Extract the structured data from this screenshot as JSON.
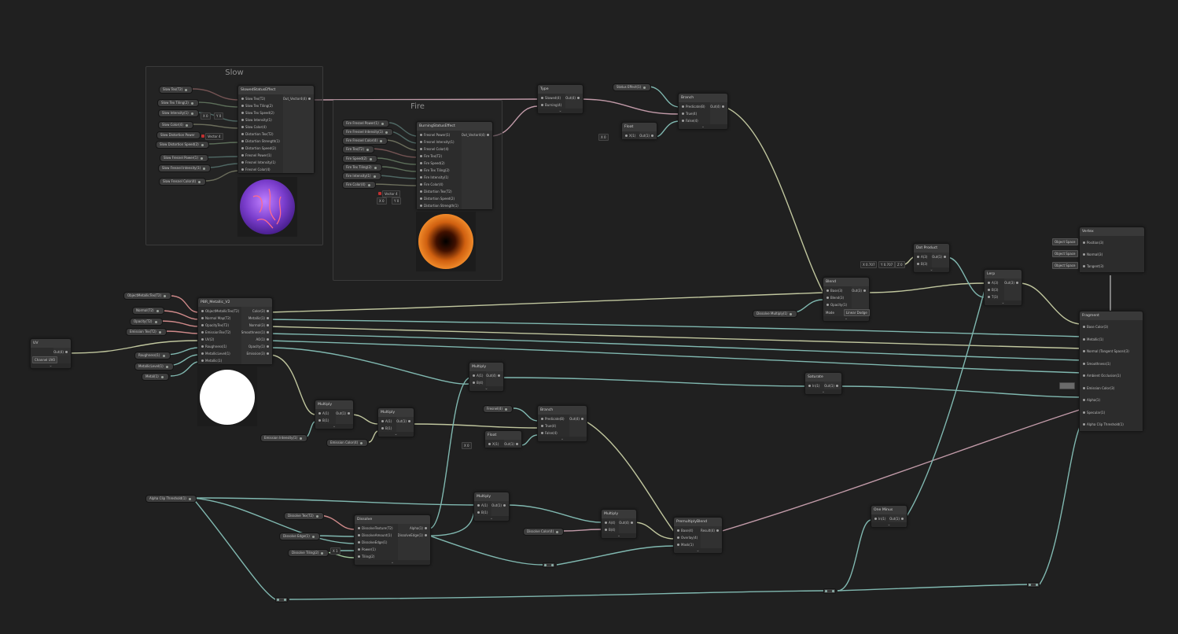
{
  "groups": {
    "slow": "Slow",
    "fire": "Fire"
  },
  "properties": {
    "slow_tex": "Slow Tex(T2)",
    "slow_tex_tiling": "Slow Tex Tiling(2)",
    "slow_intensity": "Slow Intensity(1)",
    "slow_color": "Slow Color(4)",
    "slow_distortion_power": "Slow Distortion Power",
    "slow_distortion_speed": "Slow Distortion Speed(2)",
    "slow_fresnel_power": "Slow Fresnel Power(1)",
    "slow_fresnel_intensity": "Slow Fresnel Intensity(1)",
    "slow_fresnel_color": "Slow Fresnel Color(4)",
    "fire_fresnel_power": "Fire Fresnel Power(1)",
    "fire_fresnel_intensity": "Fire Fresnel Intensity(1)",
    "fire_fresnel_color": "Fire Fresnel Color(4)",
    "fire_tex": "Fire Tex(T2)",
    "fire_speed": "Fire Speed(2)",
    "fire_tex_tiling": "Fire Tex Tiling(2)",
    "fire_intensity": "Fire Intensity(1)",
    "fire_color": "Fire Color(4)",
    "status_effect": "Status Effect(1)",
    "dissolve_multiply": "Dissolve Multiply(1)",
    "object_metallic": "ObjectMetallicTex(T2)",
    "normal": "Normal(T2)",
    "opacity": "Opacity(T2)",
    "emission_tex": "Emission Tex(T2)",
    "roughness": "Roughness(1)",
    "metallic_level": "MetallicLevel(1)",
    "metal_scale": "Metal(1)",
    "emission_intensity": "Emission Intensity(1)",
    "emission_color": "Emission Color(4)",
    "fresnel_color_prop": "Fresnel(4)",
    "alpha_clip": "Alpha Clip Threshold(1)",
    "dissolve_tex": "Dissolve Tex(T2)",
    "dissolve_edge": "Dissolve Edge(1)",
    "dissolve_tiling": "Dissolve Tiling(2)",
    "dissolve_color": "Dissolve Color(4)"
  },
  "nodes": {
    "slow_status": {
      "title": "SlowedStatusEffect",
      "inputs": [
        "Slow Tex(T2)",
        "Slow Tex Tiling(2)",
        "Slow Tex Speed(2)",
        "Slow Intensity(1)",
        "Slow Color(4)",
        "Distortion Tex(T2)",
        "Distortion Strength(1)",
        "Distortion Speed(2)",
        "Fresnel Power(1)",
        "Fresnel Intensity(1)",
        "Fresnel Color(4)"
      ],
      "outputs": [
        "Out_Vector4(4)"
      ]
    },
    "burning": {
      "title": "BurningStatusEffect",
      "inputs": [
        "Fresnel Power(1)",
        "Fresnel Intensity(1)",
        "Fresnel Color(4)",
        "Fire Tex(T2)",
        "Fire Speed(2)",
        "Fire Tex Tiling(2)",
        "Fire Intensity(1)",
        "Fire Color(4)",
        "Distortion Tex(T2)",
        "Distortion Speed(2)",
        "Distortion Strength(1)"
      ],
      "outputs": [
        "Out_Vector4(4)"
      ]
    },
    "type": {
      "title": "Type",
      "inputs": [
        "Slowed(4)",
        "Burning(4)"
      ],
      "outputs": [
        "Out(4)"
      ]
    },
    "branch_top": {
      "title": "Branch",
      "inputs": [
        "Predicate(B)",
        "True(4)",
        "False(4)"
      ],
      "outputs": [
        "Out(4)"
      ]
    },
    "float_top": {
      "title": "Float",
      "inputs": [
        "X(1)"
      ],
      "outputs": [
        "Out(1)"
      ]
    },
    "blend": {
      "title": "Blend",
      "inputs": [
        "Base(3)",
        "Blend(3)",
        "Opacity(1)"
      ],
      "outputs": [
        "Out(3)"
      ],
      "mode_label": "Mode",
      "mode_value": "Linear Dodge"
    },
    "dot_product": {
      "title": "Dot Product",
      "inputs": [
        "A(3)",
        "B(3)"
      ],
      "outputs": [
        "Out(1)"
      ]
    },
    "lerp": {
      "title": "Lerp",
      "inputs": [
        "A(3)",
        "B(3)",
        "T(3)"
      ],
      "outputs": [
        "Out(3)"
      ]
    },
    "vertex": {
      "title": "Vertex",
      "inputs": [
        "Position(3)",
        "Normal(3)",
        "Tangent(3)"
      ]
    },
    "fragment": {
      "title": "Fragment",
      "inputs": [
        "Base Color(3)",
        "Metallic(1)",
        "Normal (Tangent Space)(3)",
        "Smoothness(1)",
        "Ambient Occlusion(1)",
        "Emission Color(3)",
        "Alpha(1)",
        "Specular(1)",
        "Alpha Clip Threshold(1)"
      ]
    },
    "pbr": {
      "title": "PBR_Metallic_V2",
      "inputs": [
        "ObjectMetallicTex(T2)",
        "Normal Map(T2)",
        "OpacityTex(T2)",
        "EmissionTex(T2)",
        "UV(2)",
        "Roughness(1)",
        "MetallicLevel(1)",
        "Metallic(1)"
      ],
      "outputs": [
        "Color(3)",
        "Metallic(1)",
        "Normal(3)",
        "Smoothness(1)",
        "AO(1)",
        "Opacity(1)",
        "Emission(3)"
      ]
    },
    "uv": {
      "title": "UV",
      "outputs": [
        "Out(4)"
      ],
      "channel": "Channel UV0"
    },
    "multiply_a": {
      "title": "Multiply",
      "inputs": [
        "A(1)",
        "B(1)"
      ],
      "outputs": [
        "Out(1)"
      ]
    },
    "multiply_b": {
      "title": "Multiply",
      "inputs": [
        "A(1)",
        "B(1)"
      ],
      "outputs": [
        "Out(1)"
      ]
    },
    "multiply_c": {
      "title": "Multiply",
      "inputs": [
        "A(1)",
        "B(4)"
      ],
      "outputs": [
        "Out(4)"
      ]
    },
    "multiply_d": {
      "title": "Multiply",
      "inputs": [
        "A(1)",
        "B(1)"
      ],
      "outputs": [
        "Out(1)"
      ]
    },
    "multiply_e": {
      "title": "Multiply",
      "inputs": [
        "A(4)",
        "B(4)"
      ],
      "outputs": [
        "Out(4)"
      ]
    },
    "branch_mid": {
      "title": "Branch",
      "inputs": [
        "Predicate(B)",
        "True(4)",
        "False(4)"
      ],
      "outputs": [
        "Out(4)"
      ]
    },
    "float_mid": {
      "title": "Float",
      "inputs": [
        "X(1)"
      ],
      "outputs": [
        "Out(1)"
      ]
    },
    "saturate": {
      "title": "Saturate",
      "inputs": [
        "In(1)"
      ],
      "outputs": [
        "Out(1)"
      ]
    },
    "dissolve": {
      "title": "Dissolve",
      "inputs": [
        "DissolveTexture(T2)",
        "DissolveAmount(1)",
        "DissolveEdge(1)",
        "Power(1)",
        "Tiling(2)"
      ],
      "outputs": [
        "Alpha(1)",
        "DissolveEdge(1)"
      ]
    },
    "premultiply": {
      "title": "PremultiplyBlend",
      "inputs": [
        "Base(4)",
        "Overlay(4)",
        "Mask(1)"
      ],
      "outputs": [
        "Result(4)"
      ]
    },
    "one_minus": {
      "title": "One Minus",
      "inputs": [
        "In(1)"
      ],
      "outputs": [
        "Out(1)"
      ]
    }
  },
  "fields": {
    "slow_x": "X",
    "slow_x_val": "0",
    "slow_y": "Y",
    "slow_y_val": "0",
    "slow_vec_label": "Vector 4",
    "fire_vec_label": "Vector 4",
    "fire_x": "X",
    "fire_x_val": "0",
    "fire_y": "Y",
    "fire_y_val": "0",
    "float_top_x": "X",
    "float_top_val": "0",
    "dot_x": "X",
    "dot_x_val": "0.707",
    "dot_y": "Y",
    "dot_y_val": "0.707",
    "dot_z": "Z",
    "dot_z_val": "0",
    "float_mid_x": "X",
    "float_mid_val": "0",
    "dissolve_x": "X",
    "dissolve_x_val": "1",
    "space_pos": "Object Space",
    "space_norm": "Object Space",
    "space_tan": "Object Space"
  },
  "colors": {
    "background": "#202020",
    "wire_vec": "#c0c69e",
    "wire_float": "#80b8b0",
    "wire_tex": "#d08a8a",
    "wire_pink": "#c19aa8",
    "slow_preview": "#8a4bd8",
    "fire_preview": "#e0711a"
  },
  "icons": {
    "collapse": "chevron-down-icon"
  }
}
